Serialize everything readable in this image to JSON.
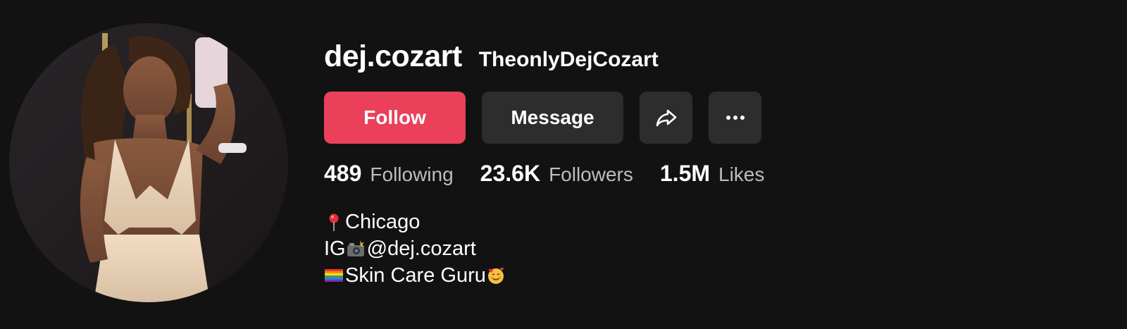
{
  "profile": {
    "username": "dej.cozart",
    "nickname": "TheonlyDejCozart"
  },
  "actions": {
    "follow_label": "Follow",
    "message_label": "Message",
    "share_icon": "share-arrow-icon",
    "more_icon": "more-dots-icon"
  },
  "stats": {
    "following": {
      "value": "489",
      "label": "Following"
    },
    "followers": {
      "value": "23.6K",
      "label": "Followers"
    },
    "likes": {
      "value": "1.5M",
      "label": "Likes"
    }
  },
  "bio": {
    "line1": {
      "icon": "pin-icon",
      "text": "Chicago"
    },
    "line2": {
      "prefix": "IG",
      "icon": "camera-flash-icon",
      "text": " @dej.cozart"
    },
    "line3": {
      "icon": "rainbow-flag-icon",
      "text": " Skin Care Guru",
      "trailing_icon": "smiling-hearts-face-icon"
    }
  },
  "colors": {
    "background": "#121212",
    "follow_button": "#ea405a",
    "secondary_button": "#2d2d2d",
    "muted_text": "#bdbdbd"
  }
}
